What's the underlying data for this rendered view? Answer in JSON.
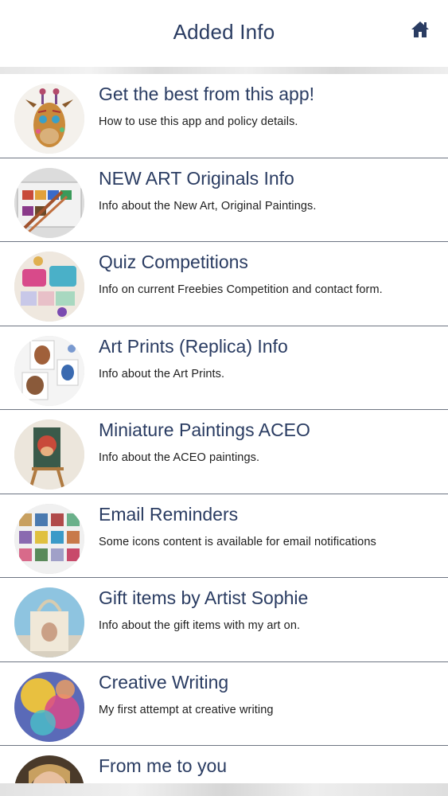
{
  "header": {
    "title": "Added Info",
    "home_icon": "home-icon"
  },
  "items": [
    {
      "title": "Get the best from this app!",
      "subtitle": "How to use this app and policy details.",
      "thumb": "giraffe-painting"
    },
    {
      "title": "NEW ART Originals Info",
      "subtitle": "Info about the New Art, Original Paintings.",
      "thumb": "watercolor-palette"
    },
    {
      "title": "Quiz Competitions",
      "subtitle": "Info on current Freebies Competition and contact form.",
      "thumb": "craft-items"
    },
    {
      "title": "Art Prints (Replica) Info",
      "subtitle": "Info about the Art Prints.",
      "thumb": "art-prints"
    },
    {
      "title": "Miniature Paintings ACEO",
      "subtitle": "Info about the ACEO paintings.",
      "thumb": "easel-miniature"
    },
    {
      "title": "Email Reminders",
      "subtitle": "Some icons content is available for email notifications",
      "thumb": "icon-grid"
    },
    {
      "title": "Gift items by Artist Sophie",
      "subtitle": "Info about the gift items with my art on.",
      "thumb": "tote-bag"
    },
    {
      "title": "Creative Writing",
      "subtitle": "My first attempt at creative writing",
      "thumb": "colorful-painting"
    },
    {
      "title": "From me to you",
      "subtitle": "",
      "thumb": "portrait-photo"
    }
  ],
  "colors": {
    "title_text": "#2a3c62",
    "divider": "#6d7482",
    "background": "#ececec"
  }
}
